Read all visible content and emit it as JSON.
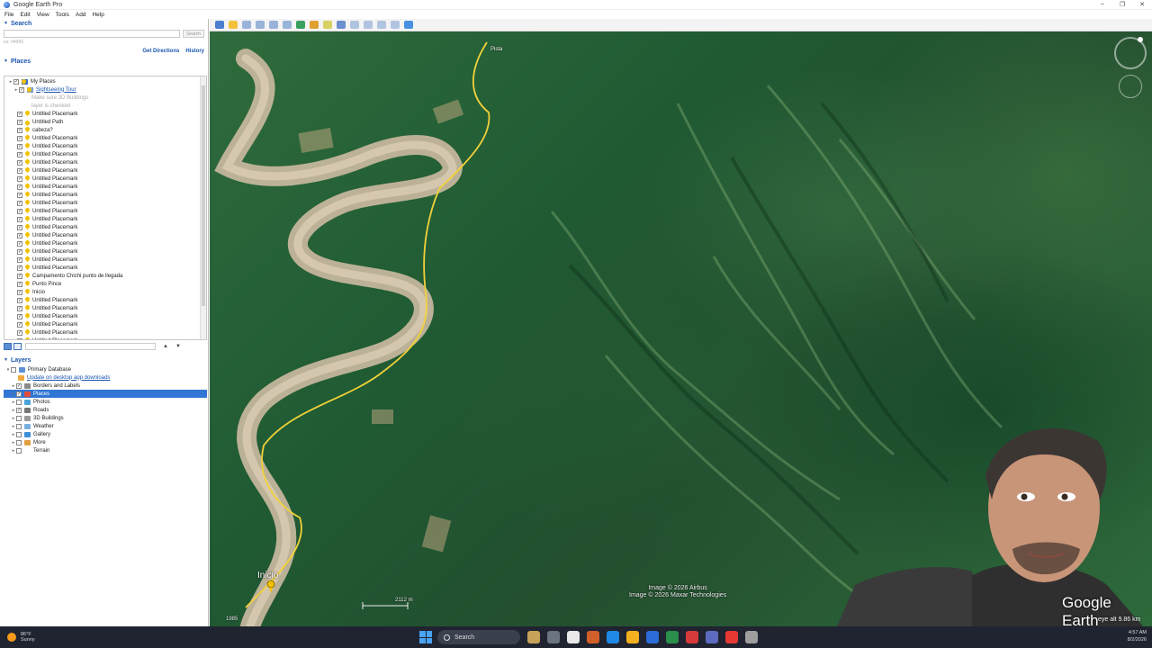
{
  "window": {
    "title": "Google Earth Pro",
    "controls": [
      "–",
      "❐",
      "✕"
    ]
  },
  "menu": [
    "File",
    "Edit",
    "View",
    "Tools",
    "Add",
    "Help"
  ],
  "search": {
    "header": "Search",
    "input_value": "",
    "button_label": "Search",
    "hint": "ex: 94043",
    "links": {
      "directions": "Get Directions",
      "history": "History"
    }
  },
  "places": {
    "header": "Places",
    "items": [
      {
        "label": "My Places",
        "type": "folder",
        "style": "normal"
      },
      {
        "label": "Sightseeing Tour",
        "type": "tour",
        "style": "link"
      },
      {
        "label": "Make sure 3D Buildings",
        "type": "note",
        "style": "muted"
      },
      {
        "label": "layer is checked",
        "type": "note",
        "style": "muted"
      },
      {
        "label": "Untitled Placemark",
        "type": "pin",
        "style": "normal"
      },
      {
        "label": "Untitled Path",
        "type": "path",
        "style": "normal"
      },
      {
        "label": "cabeza?",
        "type": "pin",
        "style": "normal"
      },
      {
        "label": "Untitled Placemark",
        "type": "pin",
        "style": "normal"
      },
      {
        "label": "Untitled Placemark",
        "type": "pin",
        "style": "normal"
      },
      {
        "label": "Untitled Placemark",
        "type": "pin",
        "style": "normal"
      },
      {
        "label": "Untitled Placemark",
        "type": "pin",
        "style": "normal"
      },
      {
        "label": "Untitled Placemark",
        "type": "pin",
        "style": "normal"
      },
      {
        "label": "Untitled Placemark",
        "type": "pin",
        "style": "normal"
      },
      {
        "label": "Untitled Placemark",
        "type": "pin",
        "style": "normal"
      },
      {
        "label": "Untitled Placemark",
        "type": "pin",
        "style": "normal"
      },
      {
        "label": "Untitled Placemark",
        "type": "pin",
        "style": "normal"
      },
      {
        "label": "Untitled Placemark",
        "type": "pin",
        "style": "normal"
      },
      {
        "label": "Untitled Placemark",
        "type": "pin",
        "style": "normal"
      },
      {
        "label": "Untitled Placemark",
        "type": "pin",
        "style": "normal"
      },
      {
        "label": "Untitled Placemark",
        "type": "pin",
        "style": "normal"
      },
      {
        "label": "Untitled Placemark",
        "type": "pin",
        "style": "normal"
      },
      {
        "label": "Untitled Placemark",
        "type": "pin",
        "style": "normal"
      },
      {
        "label": "Untitled Placemark",
        "type": "pin",
        "style": "normal"
      },
      {
        "label": "Untitled Placemark",
        "type": "pin",
        "style": "normal"
      },
      {
        "label": "Campamento Chichi punto de llegada",
        "type": "pin",
        "style": "normal"
      },
      {
        "label": "Punto Pince",
        "type": "pin",
        "style": "normal"
      },
      {
        "label": "Inicio",
        "type": "pin",
        "style": "normal"
      },
      {
        "label": "Untitled Placemark",
        "type": "pin",
        "style": "normal"
      },
      {
        "label": "Untitled Placemark",
        "type": "pin",
        "style": "normal"
      },
      {
        "label": "Untitled Placemark",
        "type": "pin",
        "style": "normal"
      },
      {
        "label": "Untitled Placemark",
        "type": "pin",
        "style": "normal"
      },
      {
        "label": "Untitled Placemark",
        "type": "pin",
        "style": "normal"
      },
      {
        "label": "Untitled Placemark",
        "type": "pin",
        "style": "normal"
      },
      {
        "label": "Untitled Placemark",
        "type": "pin",
        "style": "normal"
      }
    ]
  },
  "layers": {
    "header": "Layers",
    "items": [
      {
        "label": "Primary Database",
        "color": "#5b8fd8",
        "style": "normal",
        "selected": false
      },
      {
        "label": "Update on desktop app downloads",
        "color": "#f0a93c",
        "style": "link",
        "selected": false
      },
      {
        "label": "Borders and Labels",
        "color": "#8a8a8a",
        "style": "normal",
        "selected": false
      },
      {
        "label": "Places",
        "color": "#e24b3b",
        "style": "normal",
        "selected": true
      },
      {
        "label": "Photos",
        "color": "#4aa3d8",
        "style": "normal",
        "selected": false
      },
      {
        "label": "Roads",
        "color": "#777777",
        "style": "normal",
        "selected": false
      },
      {
        "label": "3D Buildings",
        "color": "#9a9a9a",
        "style": "normal",
        "selected": false
      },
      {
        "label": "Weather",
        "color": "#7ab0e0",
        "style": "normal",
        "selected": false
      },
      {
        "label": "Gallery",
        "color": "#3c8fd8",
        "style": "normal",
        "selected": false
      },
      {
        "label": "More",
        "color": "#e0a040",
        "style": "normal",
        "selected": false
      },
      {
        "label": "Terrain",
        "color": "#ffffff",
        "style": "normal",
        "selected": false
      }
    ]
  },
  "map": {
    "placemark_label": "Inicio",
    "copyright_1": "Image © 2026 Airbus",
    "copyright_2": "Image © 2026 Maxar Technologies",
    "scale_text": "2112 m",
    "logo": "Google Earth",
    "eye_alt": "eye alt  9.86 km",
    "year": "1985",
    "top_label": "Pista"
  },
  "taskbar": {
    "weather_temp": "86°F",
    "weather_desc": "Sunny",
    "search_label": "Search",
    "time": "4:57 AM",
    "date": "8/2/2026",
    "apps": [
      "#c7a35a",
      "#6b7280",
      "#e8e8e8",
      "#d15f2a",
      "#1e88e5",
      "#f2b01e",
      "#2b6cd8",
      "#2a8f4a",
      "#d63a3a",
      "#5c6bc0",
      "#e53935",
      "#9e9e9e"
    ]
  }
}
